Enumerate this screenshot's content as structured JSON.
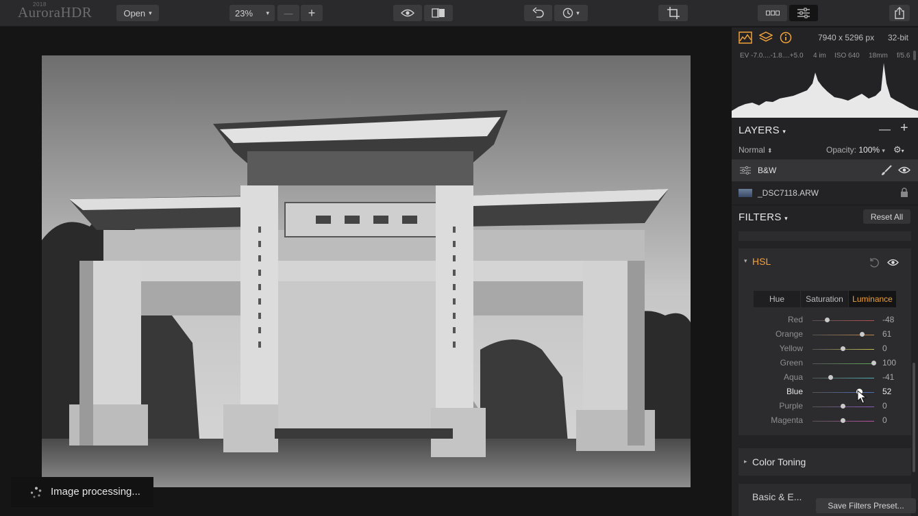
{
  "app": {
    "name": "AuroraHDR",
    "year": "2018"
  },
  "toolbar": {
    "open_label": "Open",
    "zoom": "23%"
  },
  "image_info": {
    "dimensions": "7940 x 5296 px",
    "bit_depth": "32-bit",
    "ev": "EV  -7.0....-1.8....+5.0",
    "images": "4 im",
    "iso": "ISO 640",
    "focal": "18mm",
    "aperture": "f/5.6"
  },
  "layers": {
    "title": "LAYERS",
    "blend_mode": "Normal",
    "opacity_label": "Opacity:",
    "opacity_value": "100%",
    "items": [
      {
        "name": "B&W"
      },
      {
        "name": "_DSC7118.ARW"
      }
    ]
  },
  "filters": {
    "title": "FILTERS",
    "reset_label": "Reset All",
    "hsl": {
      "title": "HSL",
      "tabs": [
        "Hue",
        "Saturation",
        "Luminance"
      ],
      "active_tab": "Luminance",
      "sliders": [
        {
          "label": "Red",
          "value": "-48",
          "color": "#b85050"
        },
        {
          "label": "Orange",
          "value": "61",
          "color": "#c98a48"
        },
        {
          "label": "Yellow",
          "value": "0",
          "color": "#c9c24f"
        },
        {
          "label": "Green",
          "value": "100",
          "color": "#5fae5a"
        },
        {
          "label": "Aqua",
          "value": "-41",
          "color": "#52b3b6"
        },
        {
          "label": "Blue",
          "value": "52",
          "color": "#4d6fc2"
        },
        {
          "label": "Purple",
          "value": "0",
          "color": "#8d5bc0"
        },
        {
          "label": "Magenta",
          "value": "0",
          "color": "#c052a7"
        }
      ]
    },
    "color_toning": "Color Toning",
    "next_filter": "Basic & E...",
    "save_preset_label": "Save Filters Preset..."
  },
  "status": {
    "processing": "Image processing..."
  },
  "colors": {
    "accent": "#f2a23a"
  }
}
